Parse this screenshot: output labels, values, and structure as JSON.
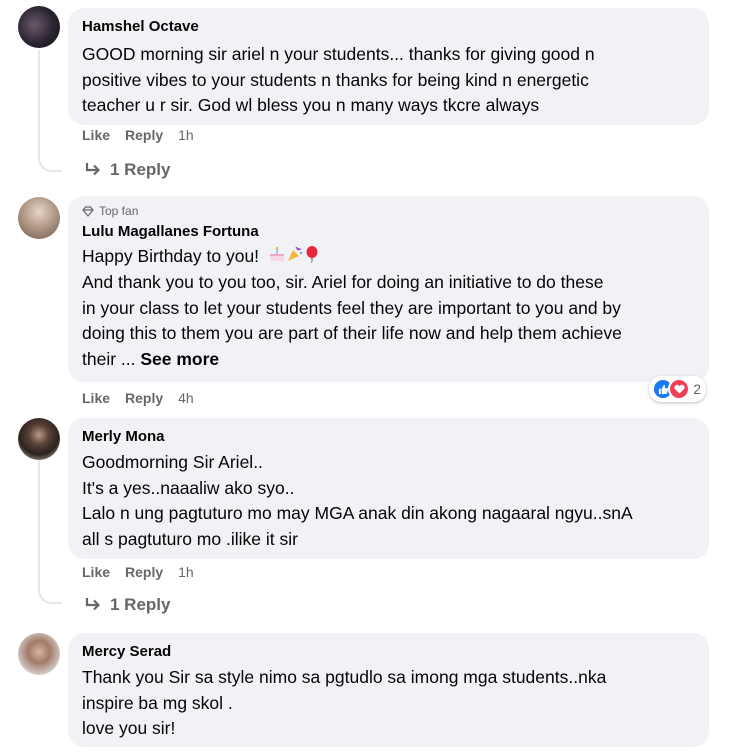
{
  "comments": [
    {
      "name": "Hamshel Octave",
      "lines": [
        "GOOD morning sir ariel n your students... thanks for giving good n",
        "positive vibes to your students n thanks for being kind n energetic",
        "teacher u r sir. God wl bless you n many ways tkcre always"
      ],
      "like": "Like",
      "reply": "Reply",
      "time": "1h",
      "replies": "1 Reply"
    },
    {
      "badge": "Top fan",
      "name": "Lulu Magallanes Fortuna",
      "lines": [
        "Happy Birthday to you!",
        "And thank you to you too, sir. Ariel for doing an initiative to do these",
        "in your class to let your students feel they are important to you and by",
        "doing this to them you are part of their life now and help them achieve",
        "their ..."
      ],
      "see_more": "See more",
      "reaction_count": "2",
      "like": "Like",
      "reply": "Reply",
      "time": "4h"
    },
    {
      "name": "Merly Mona",
      "lines": [
        "Goodmorning Sir Ariel..",
        "It's a yes..naaaliw ako syo..",
        "Lalo n ung pagtuturo mo may MGA anak din akong nagaaral ngyu..snA",
        "all s pagtuturo mo .ilike it sir"
      ],
      "like": "Like",
      "reply": "Reply",
      "time": "1h",
      "replies": "1 Reply"
    },
    {
      "name": "Mercy Serad",
      "lines": [
        "Thank you Sir sa style nimo sa pgtudlo sa imong mga students..nka",
        "inspire ba mg skol .",
        "love you sir!"
      ]
    }
  ],
  "colors": {
    "like_blue": "#1877f2",
    "love_red": "#f33e58",
    "meta_gray": "#65676b",
    "bubble": "#f0f2f5"
  },
  "icons": [
    "reply-arrow-icon",
    "top-fan-diamond-icon",
    "like-reaction-icon",
    "love-reaction-icon",
    "cake-emoji-icon",
    "party-popper-emoji-icon",
    "balloon-emoji-icon"
  ]
}
